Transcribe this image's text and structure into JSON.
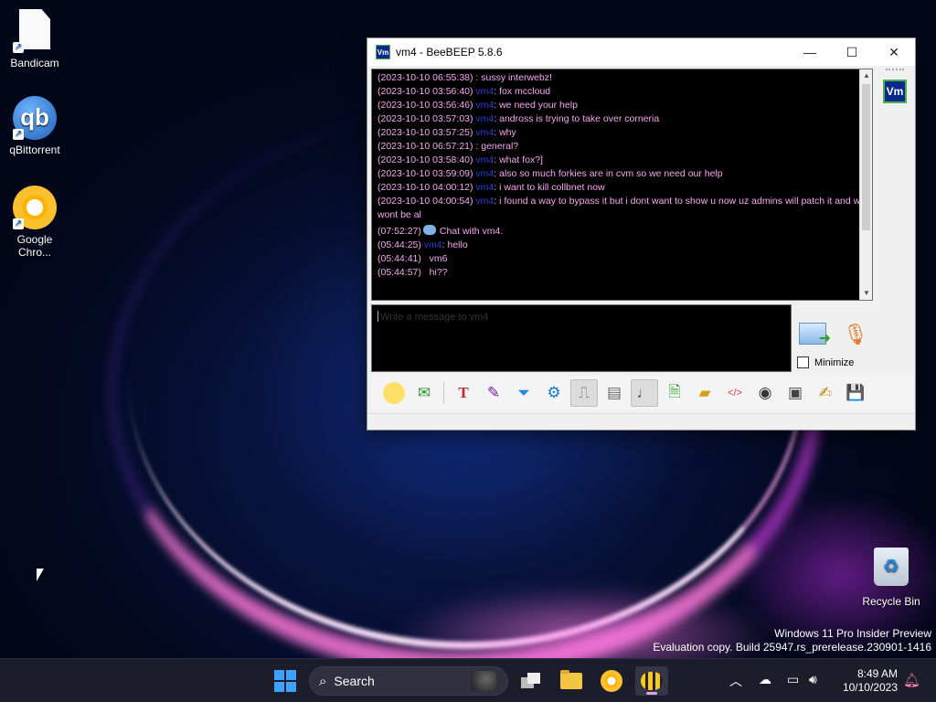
{
  "desktop": {
    "icons": [
      {
        "label": "Bandicam"
      },
      {
        "label": "qBittorrent",
        "glyph": "qb"
      },
      {
        "label": "Google Chro..."
      },
      {
        "label": "Recycle Bin"
      }
    ]
  },
  "window": {
    "title": "vm4 - BeeBEEP 5.8.6",
    "badge": "Vm",
    "controls": {
      "minimize": "—",
      "maximize": "☐",
      "close": "✕"
    }
  },
  "chat": {
    "lines": [
      {
        "ts": "(2023-10-10 06:55:38)",
        "who": "",
        "text": ": sussy interwebz!"
      },
      {
        "ts": "(2023-10-10 03:56:40)",
        "who": "vm4",
        "text": ": fox mccloud"
      },
      {
        "ts": "(2023-10-10 03:56:46)",
        "who": "vm4",
        "text": ": we need your help"
      },
      {
        "ts": "(2023-10-10 03:57:03)",
        "who": "vm4",
        "text": ": andross is   trying to take over corneria"
      },
      {
        "ts": "(2023-10-10 03:57:25)",
        "who": "vm4",
        "text": ": why"
      },
      {
        "ts": "(2023-10-10 06:57:21)",
        "who": "",
        "text": ": general?"
      },
      {
        "ts": "(2023-10-10 03:58:40)",
        "who": "vm4",
        "text": ": what fox?]"
      },
      {
        "ts": "(2023-10-10 03:59:09)",
        "who": "vm4",
        "text": ": also so much forkies are in cvm so we need our help"
      },
      {
        "ts": "(2023-10-10 04:00:12)",
        "who": "vm4",
        "text": ": i want to kill collbnet now"
      },
      {
        "ts": "(2023-10-10 04:00:54)",
        "who": "vm4",
        "text": ": i found a way to bypass it but i dont want to show u now uz admins will patch it and we wont be al"
      }
    ],
    "system_line": {
      "ts": "(07:52:27)",
      "text": "Chat with vm4."
    },
    "recent": [
      {
        "ts": "(05:44:25)",
        "who": "vm4",
        "text": ": hello"
      },
      {
        "ts": "(05:44:41)",
        "who": "",
        "text": "vm6"
      },
      {
        "ts": "(05:44:57)",
        "who": "",
        "text": "hi??"
      }
    ]
  },
  "compose": {
    "placeholder": "Write a message to vm4"
  },
  "send": {
    "minimize_label": "Minimize"
  },
  "toolbar": {
    "buttons": [
      {
        "icon": "smiley-icon"
      },
      {
        "icon": "green-envelope-icon"
      },
      {
        "icon": "font-icon"
      },
      {
        "icon": "color-picker-icon"
      },
      {
        "icon": "filter-icon"
      },
      {
        "icon": "settings-gear-icon"
      },
      {
        "icon": "stamp-icon"
      },
      {
        "icon": "spellcheck-icon"
      },
      {
        "icon": "music-note-icon"
      },
      {
        "icon": "send-file-icon"
      },
      {
        "icon": "send-folder-icon"
      },
      {
        "icon": "html-code-icon"
      },
      {
        "icon": "screenshot-icon"
      },
      {
        "icon": "terminal-icon"
      },
      {
        "icon": "notes-icon"
      },
      {
        "icon": "save-icon"
      }
    ]
  },
  "watermark": {
    "line1": "Windows 11 Pro Insider Preview",
    "line2": "Evaluation copy. Build 25947.rs_prerelease.230901-1416"
  },
  "taskbar": {
    "search_label": "Search",
    "time": "8:49 AM",
    "date": "10/10/2023"
  },
  "colors": {
    "accent": "#3ea1ff",
    "chat_bg": "#000000",
    "chat_text": "#f4a8f0",
    "chat_user": "#2a3fd6"
  }
}
